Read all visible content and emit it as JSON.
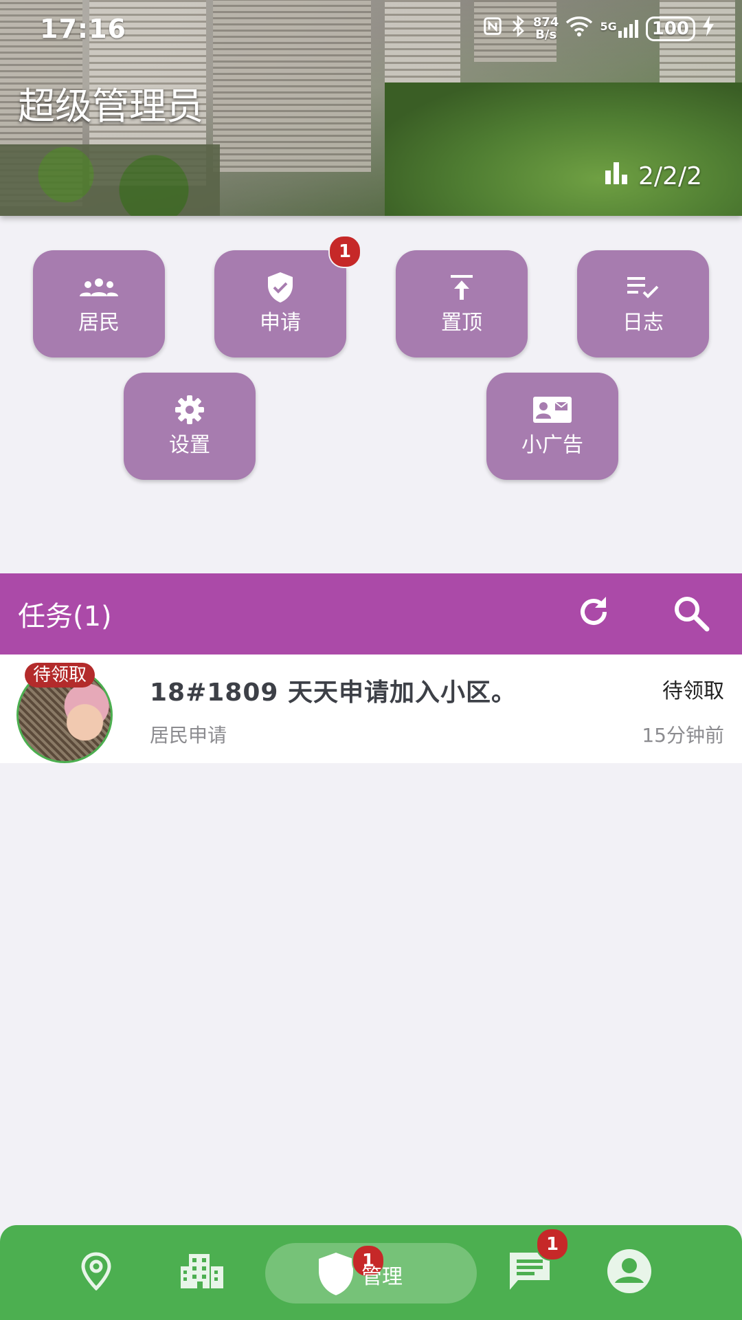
{
  "status_bar": {
    "time": "17:16",
    "net_speed_value": "874",
    "net_speed_unit": "B/s",
    "network": "5G",
    "battery": "100"
  },
  "header": {
    "title": "超级管理员",
    "stats": "2/2/2",
    "stats_icon": "bar-chart-icon"
  },
  "quick_actions": [
    {
      "label": "居民",
      "icon": "people-icon"
    },
    {
      "label": "申请",
      "icon": "shield-check-icon",
      "badge": "1"
    },
    {
      "label": "置顶",
      "icon": "pin-top-icon"
    },
    {
      "label": "日志",
      "icon": "list-check-icon"
    },
    {
      "label": "设置",
      "icon": "gear-icon"
    },
    {
      "label": "小广告",
      "icon": "contact-card-icon"
    }
  ],
  "tasks": {
    "header": "任务(1)",
    "items": [
      {
        "avatar_tag": "待领取",
        "title": "18#1809 天天申请加入小区。",
        "status": "待领取",
        "subtitle": "居民申请",
        "time": "15分钟前"
      }
    ]
  },
  "bottom_nav": {
    "active_label": "管理",
    "manage_badge": "1",
    "messages_badge": "1"
  },
  "colors": {
    "accent_purple": "#ab4aa8",
    "button_purple": "#a77caf",
    "nav_green": "#4caf50",
    "badge_red": "#c62828"
  }
}
